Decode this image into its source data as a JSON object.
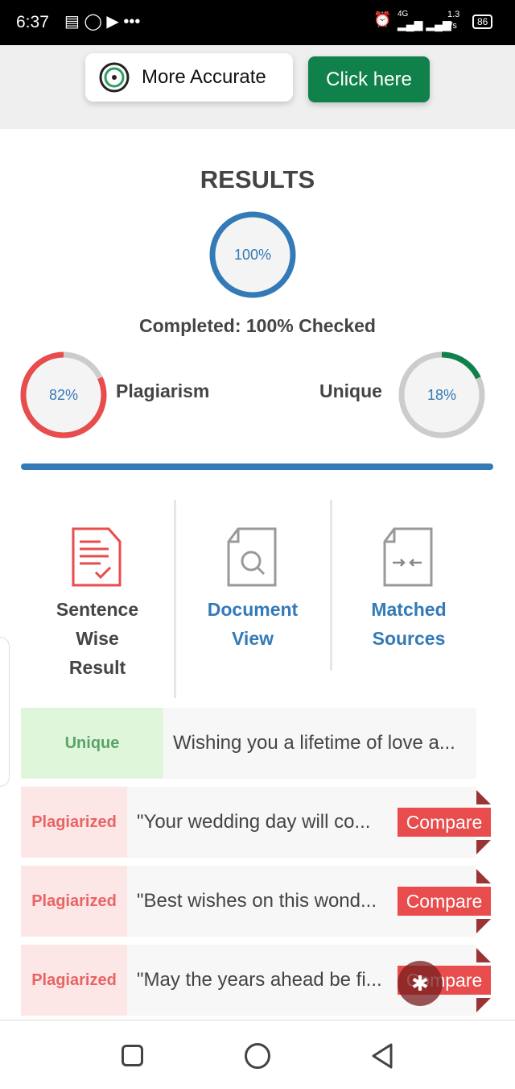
{
  "status_bar": {
    "time": "6:37",
    "network": "4G",
    "speed": "1.3",
    "speed_unit": "K/s",
    "battery": "86"
  },
  "banner": {
    "more_accurate": "More Accurate",
    "click_here": "Click here"
  },
  "results": {
    "title": "RESULTS",
    "progress": "100%",
    "progress_value": 100,
    "completed": "Completed: 100% Checked",
    "plagiarism_label": "Plagiarism",
    "plagiarism": "82%",
    "plagiarism_value": 82,
    "unique_label": "Unique",
    "unique": "18%",
    "unique_value": 18
  },
  "colors": {
    "blue": "#337ab7",
    "red": "#e84c4c",
    "green": "#10814a",
    "track": "#cccccc"
  },
  "tabs": [
    {
      "line1": "Sentence",
      "line2": "Wise",
      "line3": "Result"
    },
    {
      "line1": "Document",
      "line2": "View"
    },
    {
      "line1": "Matched",
      "line2": "Sources"
    }
  ],
  "rows": [
    {
      "status": "Unique",
      "text": "Wishing you a lifetime of love a..."
    },
    {
      "status": "Plagiarized",
      "text": "\"Your wedding day will co...",
      "action": "Compare"
    },
    {
      "status": "Plagiarized",
      "text": "\"Best wishes on this wond...",
      "action": "Compare"
    },
    {
      "status": "Plagiarized",
      "text": "\"May the years ahead be fi...",
      "action": "Compare"
    }
  ]
}
